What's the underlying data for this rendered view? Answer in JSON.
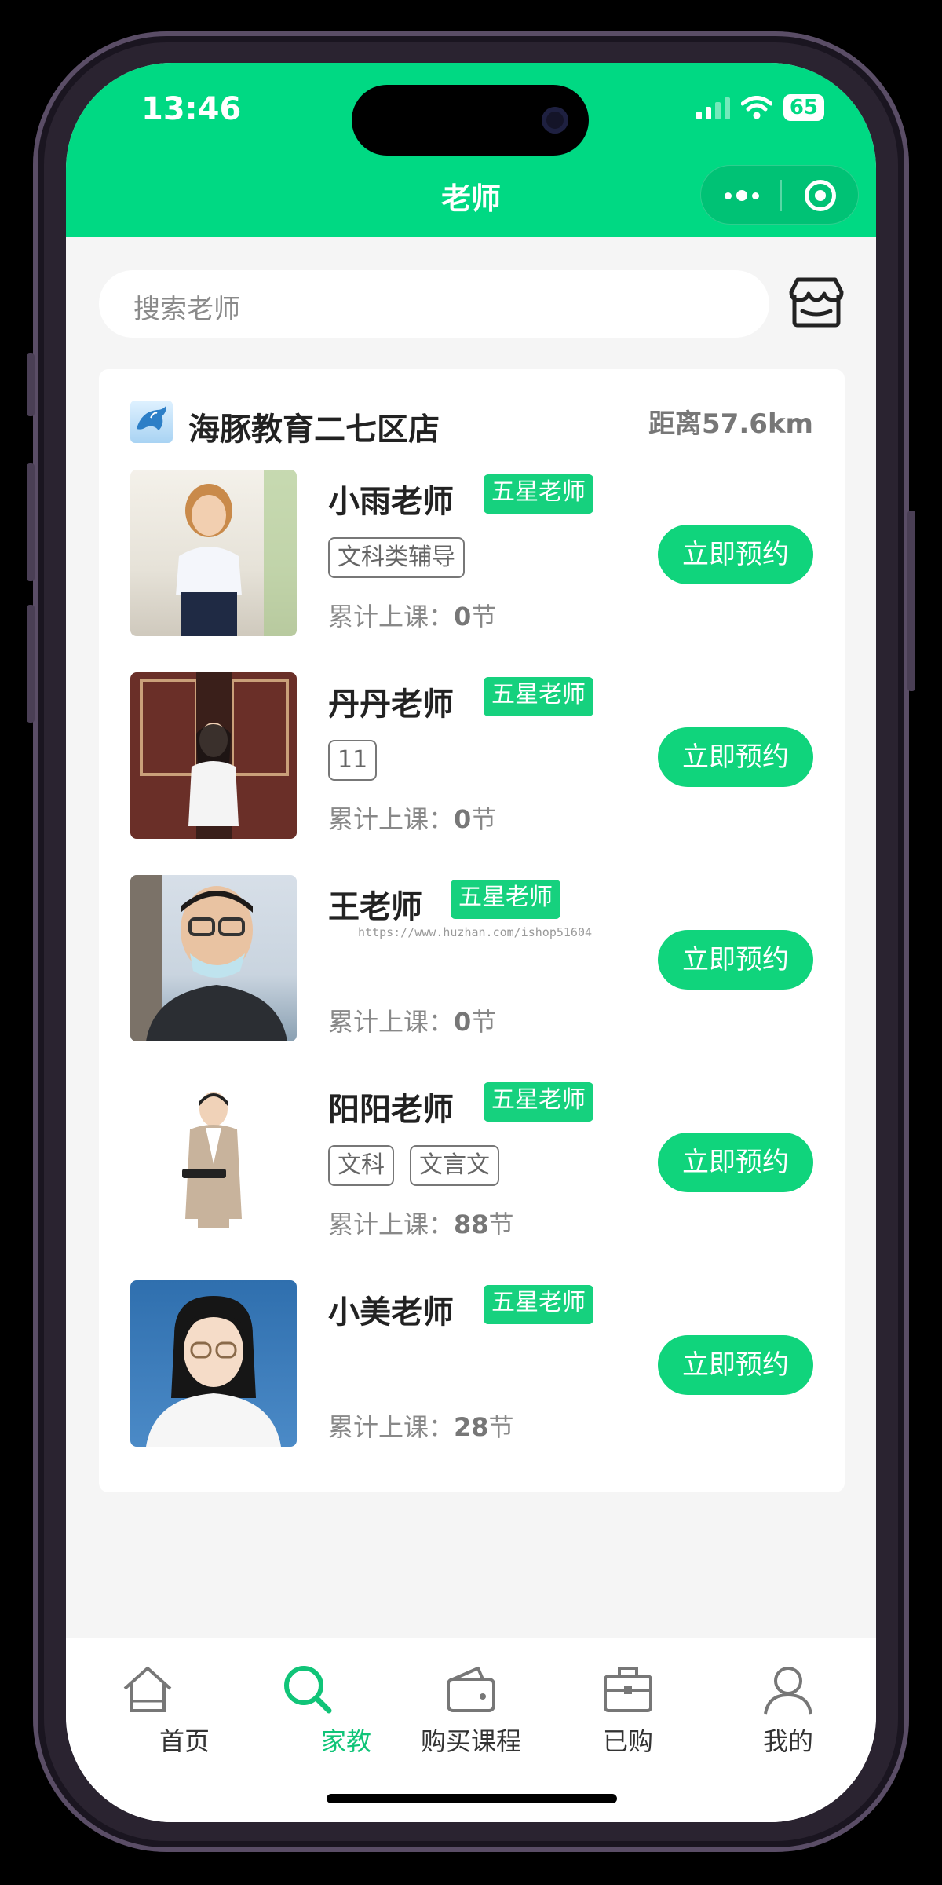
{
  "status_bar": {
    "time": "13:46",
    "battery": "65"
  },
  "nav": {
    "title": "老师"
  },
  "search": {
    "placeholder": "搜索老师"
  },
  "shop": {
    "name": "海豚教育二七区店",
    "distance": "距离57.6km"
  },
  "lessons_prefix": "累计上课：",
  "lessons_unit": "节",
  "teachers": [
    {
      "name": "小雨老师",
      "badge": "五星老师",
      "tags": [
        "文科类辅导"
      ],
      "lessons": "0",
      "button": "立即预约"
    },
    {
      "name": "丹丹老师",
      "badge": "五星老师",
      "tags": [
        "11"
      ],
      "lessons": "0",
      "button": "立即预约"
    },
    {
      "name": "王老师",
      "badge": "五星老师",
      "tags": [],
      "lessons": "0",
      "button": "立即预约",
      "watermark": "https://www.huzhan.com/ishop51604"
    },
    {
      "name": "阳阳老师",
      "badge": "五星老师",
      "tags": [
        "文科",
        "文言文"
      ],
      "lessons": "88",
      "button": "立即预约"
    },
    {
      "name": "小美老师",
      "badge": "五星老师",
      "tags": [],
      "lessons": "28",
      "button": "立即预约"
    }
  ],
  "tabbar": [
    {
      "label": "首页",
      "icon": "home-icon",
      "active": false
    },
    {
      "label": "家教",
      "icon": "search-icon",
      "active": true
    },
    {
      "label": "购买课程",
      "icon": "wallet-icon",
      "active": false
    },
    {
      "label": "已购",
      "icon": "briefcase-icon",
      "active": false
    },
    {
      "label": "我的",
      "icon": "user-icon",
      "active": false
    }
  ],
  "colors": {
    "brand": "#00d983",
    "button": "#10d47c",
    "active_tab": "#10c478"
  }
}
